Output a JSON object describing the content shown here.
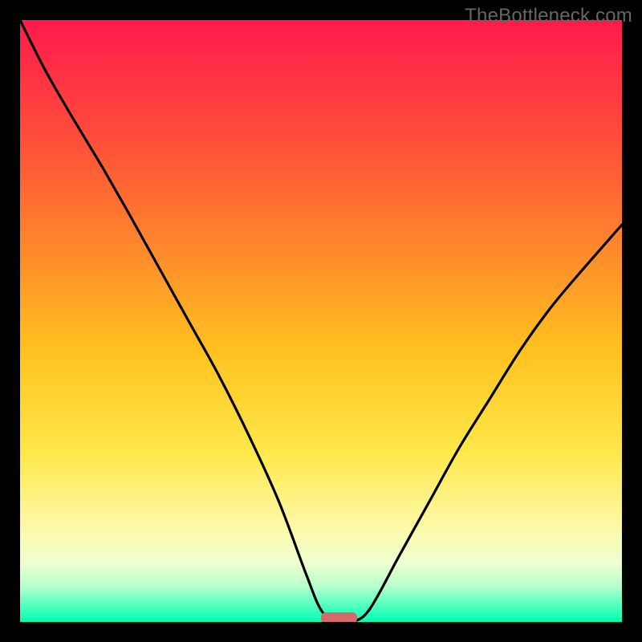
{
  "watermark": "TheBottleneck.com",
  "chart_data": {
    "type": "line",
    "title": "",
    "xlabel": "",
    "ylabel": "",
    "xlim": [
      0,
      100
    ],
    "ylim": [
      0,
      100
    ],
    "grid": false,
    "legend": false,
    "background_gradient_stops": [
      {
        "offset": 0.0,
        "color": "#ff1a4d"
      },
      {
        "offset": 0.2,
        "color": "#ff4e3a"
      },
      {
        "offset": 0.4,
        "color": "#ff8f2a"
      },
      {
        "offset": 0.55,
        "color": "#ffc21f"
      },
      {
        "offset": 0.72,
        "color": "#ffe84a"
      },
      {
        "offset": 0.83,
        "color": "#fff7a0"
      },
      {
        "offset": 0.9,
        "color": "#f0ffd0"
      },
      {
        "offset": 0.94,
        "color": "#b8ffcc"
      },
      {
        "offset": 0.97,
        "color": "#5affc0"
      },
      {
        "offset": 1.0,
        "color": "#00ffb0"
      }
    ],
    "series": [
      {
        "name": "bottleneck-curve",
        "color": "#000000",
        "x": [
          0,
          4,
          8,
          11,
          14,
          18,
          23,
          28,
          33,
          38,
          43,
          47.5,
          50,
          52.5,
          55,
          58,
          63,
          68,
          73,
          78,
          83,
          88,
          93,
          100
        ],
        "y": [
          100,
          92,
          85,
          80,
          75,
          68,
          59,
          50,
          41,
          31,
          20,
          8,
          2,
          0,
          0,
          2,
          11,
          20,
          29,
          37,
          45,
          52,
          58,
          66
        ]
      }
    ],
    "marker": {
      "name": "optimal-marker",
      "x_center": 53,
      "width": 6,
      "y": 0,
      "color": "#d46a6a"
    }
  },
  "colors": {
    "frame": "#000000",
    "curve": "#000000"
  }
}
